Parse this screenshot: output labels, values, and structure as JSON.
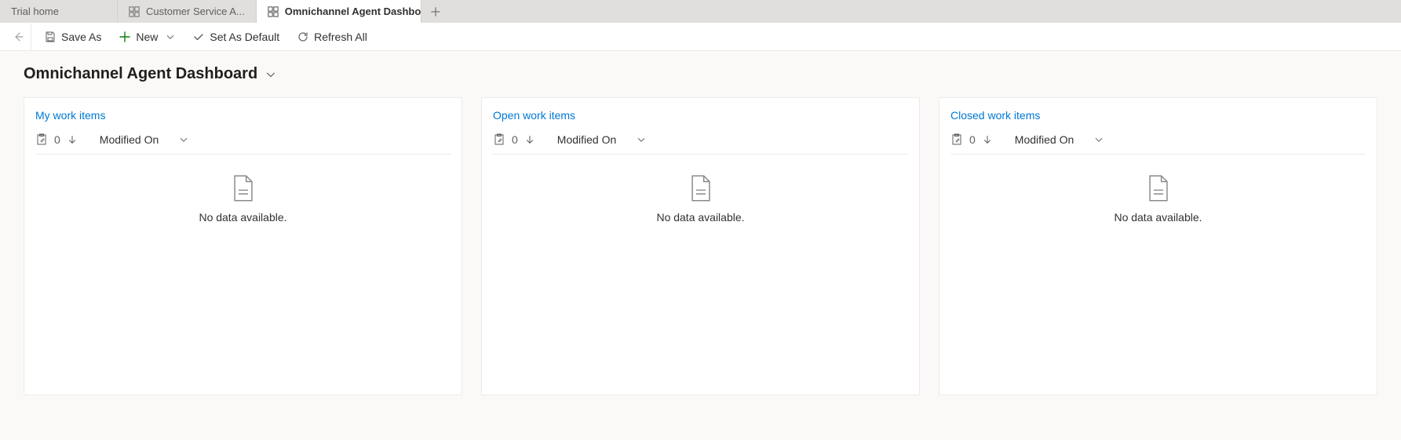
{
  "tabs": [
    {
      "label": "Trial home",
      "icon": null,
      "active": false
    },
    {
      "label": "Customer Service A...",
      "icon": "workspace-icon",
      "active": false
    },
    {
      "label": "Omnichannel Agent Dashboard",
      "icon": "workspace-icon",
      "active": true
    }
  ],
  "commands": {
    "save_as": "Save As",
    "new": "New",
    "set_default": "Set As Default",
    "refresh_all": "Refresh All"
  },
  "page_title": "Omnichannel Agent Dashboard",
  "cards": [
    {
      "title": "My work items",
      "count": "0",
      "sort_field": "Modified On",
      "empty": "No data available."
    },
    {
      "title": "Open work items",
      "count": "0",
      "sort_field": "Modified On",
      "empty": "No data available."
    },
    {
      "title": "Closed work items",
      "count": "0",
      "sort_field": "Modified On",
      "empty": "No data available."
    }
  ]
}
